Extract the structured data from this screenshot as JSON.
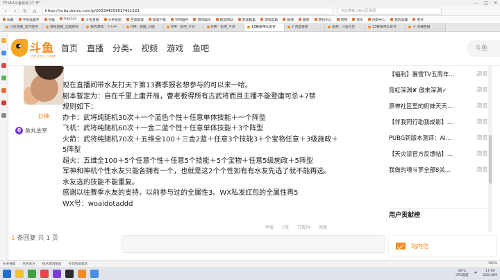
{
  "window": {
    "title": "TP-VLA斗鱼论坛 17.7F",
    "controls": [
      "—",
      "□",
      "✕"
    ]
  },
  "address_bar": {
    "url": "https://yuba.douyu.com/p/283394291617411521",
    "search_placeholder": "在此搜索斗鱼社区新闻"
  },
  "bookmarks": [
    "收藏",
    "手机收藏夹",
    "谷歌",
    "hao123",
    "斗鱼直播",
    "头条新闻",
    "百度翻译",
    "新闻下载",
    "VPN插件",
    "游戏娱乐",
    "精品网站",
    "影视剧集",
    "游戏帮助",
    "微博",
    "最新",
    "游戏中心",
    "购物",
    "音乐",
    "视频中心",
    "我的收藏",
    "更多"
  ],
  "tabs": [
    {
      "label": "斗鱼直播_官方提供",
      "active": false
    },
    {
      "label": "游戏直播_全国游戏",
      "active": false
    },
    {
      "label": "我的游戏 · 个人中",
      "active": false
    },
    {
      "label": "D神 · 直播_三国",
      "active": false
    },
    {
      "label": "D神 · 鱼吧_今日",
      "active": false
    },
    {
      "label": "D神 · 鱼吧_今日",
      "active": false
    },
    {
      "label": "13赛季带水友打",
      "active": true
    },
    {
      "label": "2 百度搜索",
      "active": false
    },
    {
      "label": "鱼吧 · 斗鱼社区",
      "active": false
    },
    {
      "label": "13赛季带水友打",
      "active": false
    },
    {
      "label": "十 点播直播",
      "active": false
    }
  ],
  "header": {
    "brand": "斗鱼",
    "brand_sub": "DOUYU.COM",
    "nav": [
      "首页",
      "直播",
      "分类",
      "视频",
      "游戏",
      "鱼吧"
    ],
    "search_placeholder": "斗鱼"
  },
  "post": {
    "username": "D神",
    "fan_level": "0",
    "fan_name": "鱼丸主宰",
    "lines": [
      "现在直播间带水友打天下第13赛季报名想参与的可以来一哈。",
      "剧本暂定为：自在千里上庸开局，曹老板得所有古武将而且主播不能登庸可杀+7禁",
      "规则如下：",
      "办卡：武将纯随机30次＋一个蓝色个性＋任意单体技能＋一个阵型",
      "飞机：武将纯随机60次＋一金二蓝个性＋任意单体技能＋3个阵型",
      "火箭：武将纯随机70次＋五维全100＋三金2蓝＋任意3个技能3＋个宝物任意＋3级施政＋",
      "5阵型",
      "超火：五维全100＋5个任意个性＋任意5个技能＋5个宝物＋任意5级施政＋5阵型",
      "军神和神机个性水友只能各拥有一个，也就是这2个个性如有有水友先选了就不能再选。",
      "水友选的技能不能重复。",
      "感谢以往赛季水友的支持，以前参与过的全属性3。WX私发红包的全属性再5",
      "WX号：woaidotaddd"
    ],
    "actions": [
      "举报",
      "1楼",
      "只看TA",
      "回复"
    ]
  },
  "pagination": {
    "page": "1",
    "text": "条回复 共 1 页"
  },
  "sidebar": {
    "items": [
      {
        "title": "【福利】暴雪TV五周年…",
        "views": "浏览"
      },
      {
        "title": "霓虹深渊✘ 傲来深渊✓",
        "views": "浏览"
      },
      {
        "title": "原神社区里的奶妹天天…",
        "views": "浏览"
      },
      {
        "title": "【伴我同行助我成影】…",
        "views": "浏览"
      },
      {
        "title": "PUBG新版本测评：AI…",
        "views": "浏览"
      },
      {
        "title": "【天灾读官方反馈帖】…",
        "views": "浏览"
      },
      {
        "title": "我做的魂斗罗全部8关…",
        "views": "浏览"
      }
    ],
    "contrib_heading": "用户贡献榜"
  },
  "message": {
    "label": "站内信"
  },
  "status_bar": {
    "left": [
      "头条搜索",
      "热点关注",
      "技术资讯搜索",
      "今日热榜资讯"
    ],
    "right": [
      "100%"
    ]
  },
  "taskbar": {
    "weather": "59°C",
    "cpu": "CPU温度",
    "ime": "中",
    "time": "17:09",
    "date": "2021/4/9"
  },
  "colors": {
    "brand": "#f68a1f",
    "fan_badge": "#7b3fd6"
  }
}
